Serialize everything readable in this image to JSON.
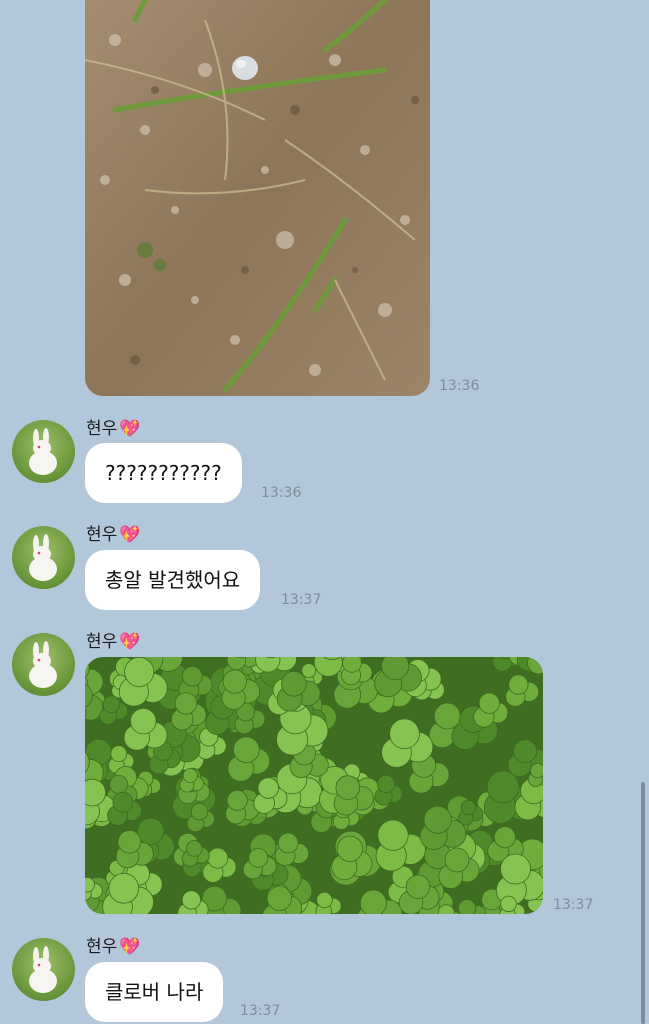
{
  "messages": [
    {
      "type": "image",
      "subject": "dirt ground with grass and a small egg",
      "time": "13:36"
    },
    {
      "sender": "현우",
      "sender_emoji": "💖",
      "text": "???????????",
      "time": "13:36"
    },
    {
      "sender": "현우",
      "sender_emoji": "💖",
      "text": "총알 발견했어요",
      "time": "13:37"
    },
    {
      "sender": "현우",
      "sender_emoji": "💖",
      "type": "image",
      "subject": "clover patch",
      "time": "13:37"
    },
    {
      "sender": "현우",
      "sender_emoji": "💖",
      "text": "클로버 나라",
      "time": "13:37"
    }
  ],
  "colors": {
    "background": "#b2c7d9",
    "bubble": "#ffffff",
    "timestamp": "#7f8c99",
    "heart": "#e84a9c"
  },
  "icons": {
    "avatar": "white-rabbit-on-grass",
    "sender_heart": "sparkling-heart-icon"
  }
}
